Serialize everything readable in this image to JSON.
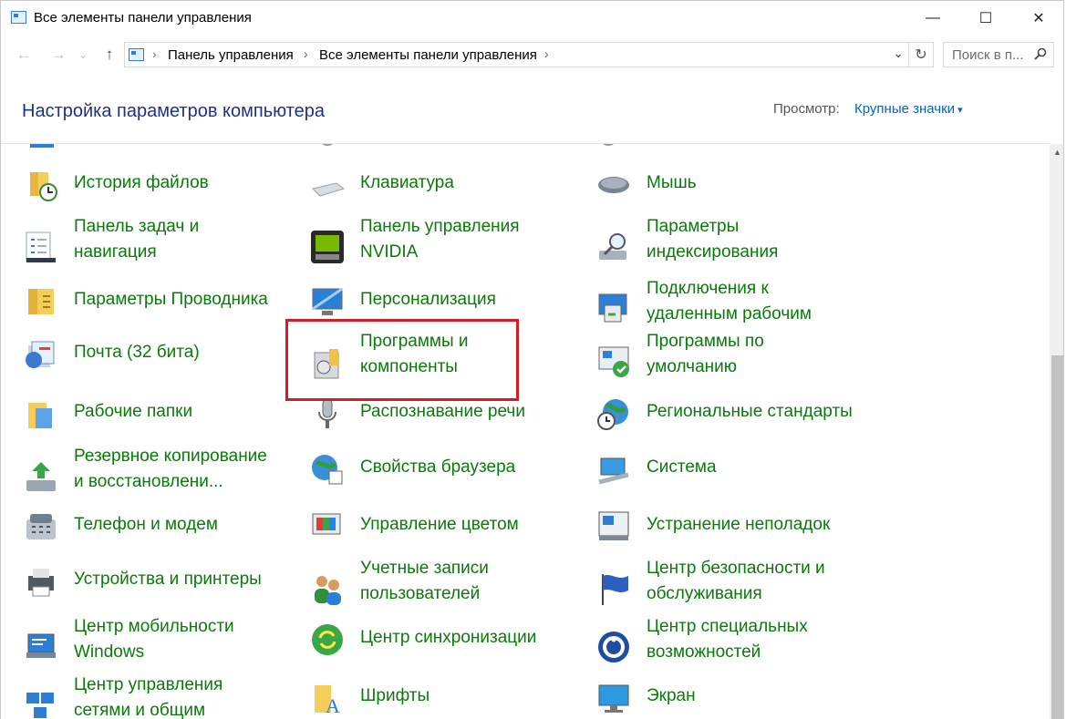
{
  "window": {
    "title": "Все элементы панели управления",
    "minimize": "—",
    "maximize": "☐",
    "close": "✕"
  },
  "nav": {
    "back": "←",
    "forward": "→",
    "recent": "⌄",
    "up": "↑",
    "breadcrumbs": [
      "Панель управления",
      "Все элементы панели управления"
    ],
    "separator": "›",
    "dropdown": "⌄",
    "refresh": "↻",
    "search_placeholder": "Поиск в п..."
  },
  "header": {
    "title": "Настройка параметров компьютера",
    "view_label": "Просмотр:",
    "view_value": "Крупные значки"
  },
  "columns": [
    [
      {
        "label": "История файлов",
        "icon": "file-history-icon"
      },
      {
        "label": "Панель задач и\nнавигация",
        "icon": "taskbar-icon"
      },
      {
        "label": "Параметры Проводника",
        "icon": "explorer-options-icon"
      },
      {
        "label": "Почта (32 бита)",
        "icon": "mail-icon"
      },
      {
        "label": "Рабочие папки",
        "icon": "work-folders-icon"
      },
      {
        "label": "Резервное копирование\nи восстановлени...",
        "icon": "backup-icon"
      },
      {
        "label": "Телефон и модем",
        "icon": "phone-modem-icon"
      },
      {
        "label": "Устройства и принтеры",
        "icon": "devices-printers-icon"
      },
      {
        "label": "Центр мобильности\nWindows",
        "icon": "mobility-center-icon"
      },
      {
        "label": "Центр управления\nсетями и общим",
        "icon": "network-center-icon"
      }
    ],
    [
      {
        "label": "Клавиатура",
        "icon": "keyboard-icon"
      },
      {
        "label": "Панель управления\nNVIDIA",
        "icon": "nvidia-icon"
      },
      {
        "label": "Персонализация",
        "icon": "personalization-icon"
      },
      {
        "label": "Программы и\nкомпоненты",
        "icon": "programs-features-icon"
      },
      {
        "label": "Распознавание речи",
        "icon": "microphone-icon"
      },
      {
        "label": "Свойства браузера",
        "icon": "internet-options-icon"
      },
      {
        "label": "Управление цветом",
        "icon": "color-management-icon"
      },
      {
        "label": "Учетные записи\nпользователей",
        "icon": "user-accounts-icon"
      },
      {
        "label": "Центр синхронизации",
        "icon": "sync-center-icon"
      },
      {
        "label": "Шрифты",
        "icon": "fonts-icon"
      }
    ],
    [
      {
        "label": "Мышь",
        "icon": "mouse-icon"
      },
      {
        "label": "Параметры\nиндексирования",
        "icon": "indexing-icon"
      },
      {
        "label": "Подключения к\nудаленным рабочим",
        "icon": "remote-desktop-icon"
      },
      {
        "label": "Программы по\nумолчанию",
        "icon": "default-programs-icon"
      },
      {
        "label": "Региональные стандарты",
        "icon": "region-icon"
      },
      {
        "label": "Система",
        "icon": "system-icon"
      },
      {
        "label": "Устранение неполадок",
        "icon": "troubleshooting-icon"
      },
      {
        "label": "Центр безопасности и\nобслуживания",
        "icon": "security-flag-icon"
      },
      {
        "label": "Центр специальных\nвозможностей",
        "icon": "accessibility-icon"
      },
      {
        "label": "Экран",
        "icon": "display-icon"
      }
    ]
  ]
}
